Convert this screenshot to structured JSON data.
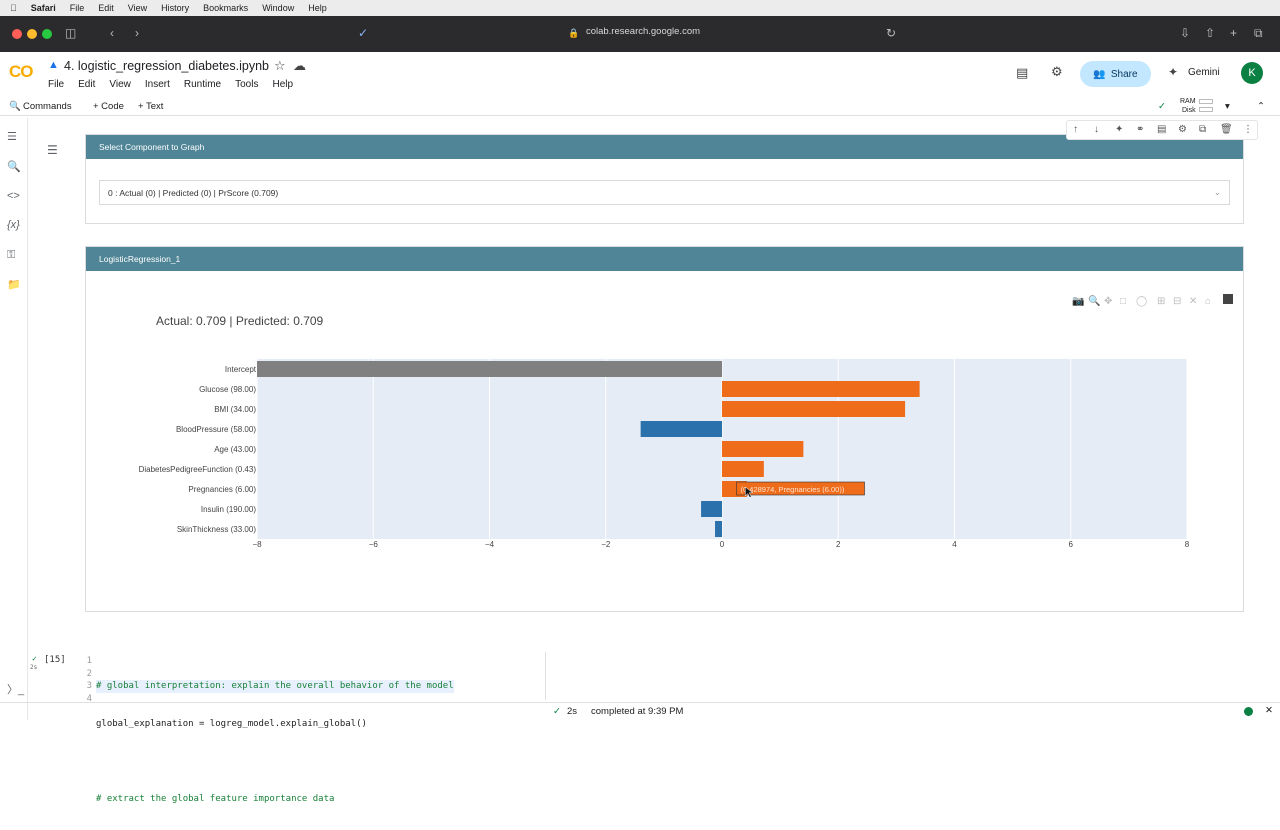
{
  "menubar": {
    "app": "Safari",
    "items": [
      "File",
      "Edit",
      "View",
      "History",
      "Bookmarks",
      "Window",
      "Help"
    ]
  },
  "browser": {
    "url": "colab.research.google.com"
  },
  "colab": {
    "logo": "CO",
    "notebook_title": "4. logistic_regression_diabetes.ipynb",
    "menus": [
      "File",
      "Edit",
      "View",
      "Insert",
      "Runtime",
      "Tools",
      "Help"
    ],
    "share_label": "Share",
    "gemini_label": "Gemini",
    "avatar_letter": "K",
    "commands_label": "Commands",
    "add_code_label": "+ Code",
    "add_text_label": "+ Text",
    "ram_label": "RAM",
    "disk_label": "Disk"
  },
  "widget": {
    "select_header": "Select Component to Graph",
    "selected_option": "0 : Actual (0) | Predicted (0) | PrScore (0.709)",
    "graph_header": "LogisticRegression_1"
  },
  "chart_data": {
    "type": "bar",
    "orientation": "horizontal",
    "title": "Actual: 0.709 | Predicted: 0.709",
    "categories": [
      "Intercept",
      "Glucose (98.00)",
      "BMI (34.00)",
      "BloodPressure (58.00)",
      "Age (43.00)",
      "DiabetesPedigreeFunction (0.43)",
      "Pregnancies (6.00)",
      "Insulin (190.00)",
      "SkinThickness (33.00)"
    ],
    "values": [
      -8.0,
      3.4,
      3.15,
      -1.4,
      1.4,
      0.72,
      0.428974,
      -0.36,
      -0.12
    ],
    "colors": [
      "#808080",
      "#ef6c1a",
      "#ef6c1a",
      "#2b72ad",
      "#ef6c1a",
      "#ef6c1a",
      "#ef6c1a",
      "#2b72ad",
      "#2b72ad"
    ],
    "xlim": [
      -8,
      8
    ],
    "xticks": [
      -8,
      -6,
      -4,
      -2,
      0,
      2,
      4,
      6,
      8
    ],
    "xtick_labels": [
      "−8",
      "−6",
      "−4",
      "−2",
      "0",
      "2",
      "4",
      "6",
      "8"
    ],
    "grid": true,
    "tooltip": "(0.428974, Pregnancies (6.00))"
  },
  "code_cell": {
    "exec_count": "[15]",
    "exec_time": "2s",
    "lines": [
      {
        "num": "1",
        "text": "# global interpretation: explain the overall behavior of the model"
      },
      {
        "num": "2",
        "text": "global_explanation = logreg_model.explain_global()"
      },
      {
        "num": "3",
        "text": ""
      },
      {
        "num": "4",
        "text": "# extract the global feature importance data"
      }
    ]
  },
  "status": {
    "time": "2s",
    "message": "completed at 9:39 PM"
  }
}
